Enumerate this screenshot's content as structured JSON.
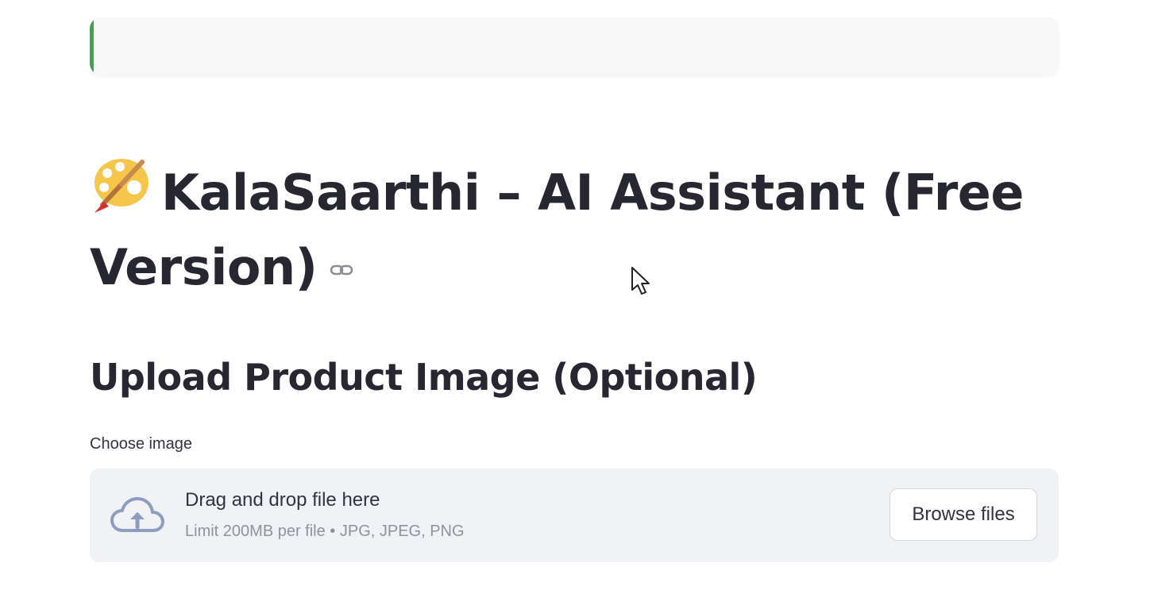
{
  "header": {
    "title": "KalaSaarthi – AI Assistant (Free Version)",
    "title_icon": "artist-palette-icon",
    "anchor_icon": "link-icon"
  },
  "upload_section": {
    "heading": "Upload Product Image (Optional)",
    "field_label": "Choose image",
    "dropzone": {
      "icon": "cloud-upload-icon",
      "instruction": "Drag and drop file here",
      "limits": "Limit 200MB per file • JPG, JPEG, PNG",
      "browse_label": "Browse files"
    }
  },
  "colors": {
    "accent_green": "#3ea34a",
    "text_dark": "#262730",
    "dropzone_bg": "#f0f2f6",
    "muted_text": "#8f929c",
    "icon_blue": "#8c9dbf"
  }
}
